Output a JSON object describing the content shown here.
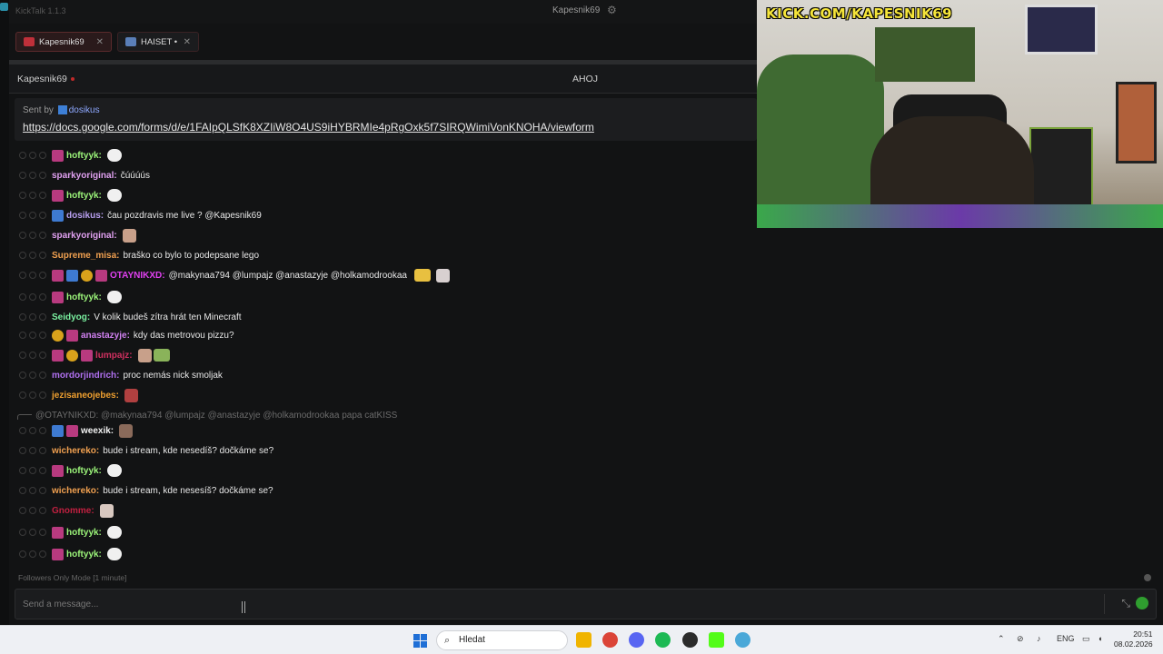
{
  "app": {
    "name": "KickTalk 1.1.3",
    "current_user": "Kapesnik69"
  },
  "tabs": [
    {
      "label": "Kapesnik69"
    },
    {
      "label": "HAISET •"
    }
  ],
  "channel": {
    "name": "Kapesnik69",
    "stream_title": "AHOJ"
  },
  "pinned": {
    "sent_by_prefix": "Sent by",
    "sent_by_user": "dosikus",
    "link": "https://docs.google.com/forms/d/e/1FAIpQLSfK8XZIiW8O4US9iHYBRMIe4pRgOxk5f7SIRQWimiVonKNOHA/viewform"
  },
  "messages": [
    {
      "user": "hoftyyk:",
      "text": "",
      "color": "#9cf57a"
    },
    {
      "user": "sparkyoriginal:",
      "text": "čúúúús",
      "color": "#e0a0f0"
    },
    {
      "user": "hoftyyk:",
      "text": "",
      "color": "#9cf57a"
    },
    {
      "user": "dosikus:",
      "text": "čau pozdravis me live ? @Kapesnik69",
      "color": "#b89ff0"
    },
    {
      "user": "sparkyoriginal:",
      "text": "",
      "color": "#e0a0f0"
    },
    {
      "user": "Supreme_misa:",
      "text": "braško co bylo to podepsane lego",
      "color": "#f0a050"
    },
    {
      "user": "OTAYNIKXD:",
      "text": "@makynaa794 @lumpajz @anastazyje @holkamodrookaa",
      "color": "#e040f0"
    },
    {
      "user": "hoftyyk:",
      "text": "",
      "color": "#9cf57a"
    },
    {
      "user": "Seidyog:",
      "text": "V kolik budeš zítra hrát ten Minecraft",
      "color": "#7af0a0"
    },
    {
      "user": "anastazyje:",
      "text": "kdy das metrovou pizzu?",
      "color": "#d080f0"
    },
    {
      "user": "lumpajz:",
      "text": "",
      "color": "#d03060"
    },
    {
      "user": "mordorjindrich:",
      "text": "proc nemás nick smoljak",
      "color": "#b070f0"
    },
    {
      "user": "jezisaneojebes:",
      "text": "",
      "color": "#f0a030"
    },
    {
      "reply": "@OTAYNIKXD: @makynaa794 @lumpajz @anastazyje @holkamodrookaa papa catKISS"
    },
    {
      "user": "weexik:",
      "text": "",
      "color": "#f0f0f0"
    },
    {
      "user": "wichereko:",
      "text": "bude i stream, kde nesedíš? dočkáme se?",
      "color": "#f0a050"
    },
    {
      "user": "hoftyyk:",
      "text": "",
      "color": "#9cf57a"
    },
    {
      "user": "wichereko:",
      "text": "bude i stream, kde nesesíš? dočkáme se?",
      "color": "#f0a050"
    },
    {
      "user": "Gnomme:",
      "text": "",
      "color": "#c02040"
    },
    {
      "user": "hoftyyk:",
      "text": "",
      "color": "#9cf57a"
    },
    {
      "user": "hoftyyk:",
      "text": "",
      "color": "#9cf57a"
    }
  ],
  "footer": {
    "mode": "Followers Only Mode [1 minute]"
  },
  "input": {
    "placeholder": "Send a message..."
  },
  "stream": {
    "caption": "KICK.COM/KAPESNIK69"
  },
  "taskbar": {
    "search_label": "Hledat",
    "lang": "ENG",
    "time": "20:51",
    "date": "08.02.2026"
  },
  "colors": {
    "accent": "#53fc18",
    "background": "#121314"
  }
}
